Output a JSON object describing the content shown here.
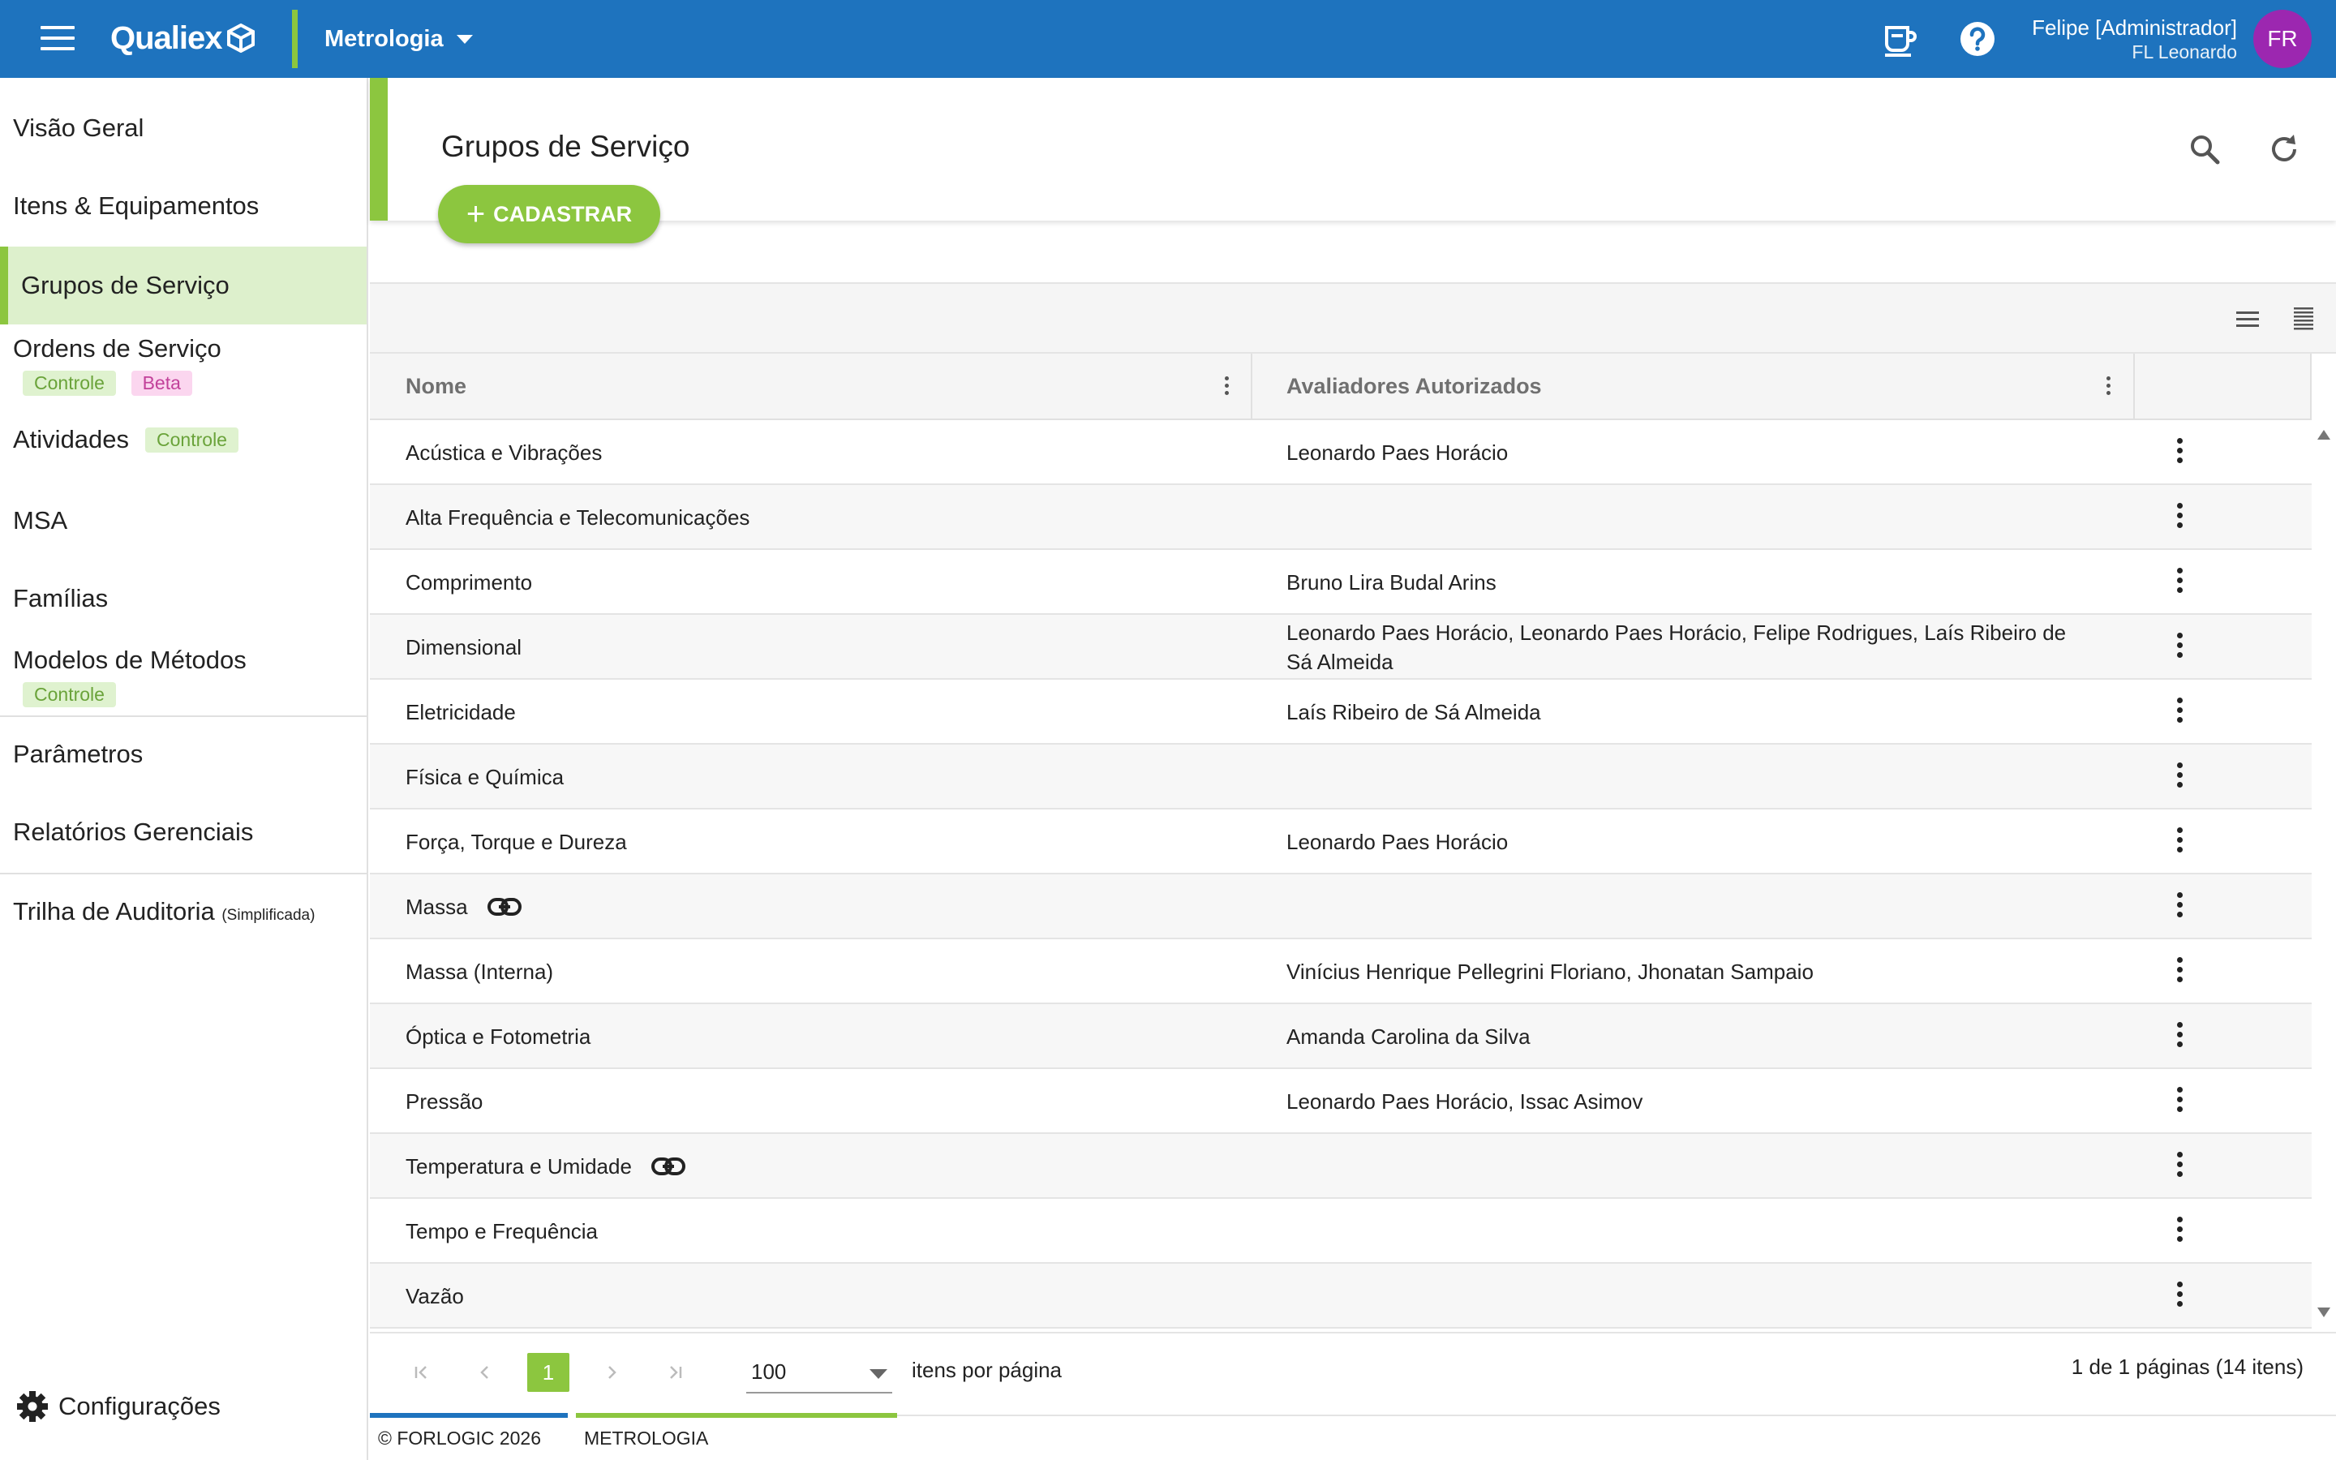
{
  "topbar": {
    "brand": "Qualiex",
    "module": "Metrologia",
    "user_name": "Felipe [Administrador]",
    "user_org": "FL Leonardo",
    "avatar_initials": "FR",
    "avatar_color": "#9c27b0",
    "color": "#1e73be"
  },
  "sidebar": {
    "items": [
      {
        "label": "Visão Geral"
      },
      {
        "label": "Itens & Equipamentos"
      },
      {
        "label": "Grupos de Serviço",
        "active": true
      },
      {
        "label": "Ordens de Serviço",
        "badges": [
          "Controle",
          "Beta"
        ]
      },
      {
        "label": "Atividades",
        "badges": [
          "Controle"
        ]
      },
      {
        "label": "MSA"
      },
      {
        "label": "Famílias"
      },
      {
        "label": "Modelos de Métodos",
        "badges": [
          "Controle"
        ]
      },
      {
        "label": "Parâmetros"
      },
      {
        "label": "Relatórios Gerenciais"
      },
      {
        "label": "Trilha de Auditoria",
        "suffix": "(Simplificada)"
      }
    ],
    "config_label": "Configurações",
    "accent": "#8cc63f"
  },
  "page": {
    "title": "Grupos de Serviço",
    "create_label": "CADASTRAR"
  },
  "table": {
    "columns": [
      "Nome",
      "Avaliadores Autorizados"
    ],
    "rows": [
      {
        "nome": "Acústica e Vibrações",
        "avaliadores": "Leonardo Paes Horácio",
        "link": false
      },
      {
        "nome": "Alta Frequência e Telecomunicações",
        "avaliadores": "",
        "link": false
      },
      {
        "nome": "Comprimento",
        "avaliadores": "Bruno Lira Budal Arins",
        "link": false
      },
      {
        "nome": "Dimensional",
        "avaliadores": "Leonardo Paes Horácio, Leonardo Paes Horácio, Felipe Rodrigues, Laís Ribeiro de Sá Almeida",
        "link": false
      },
      {
        "nome": "Eletricidade",
        "avaliadores": "Laís Ribeiro de Sá Almeida",
        "link": false
      },
      {
        "nome": "Física e Química",
        "avaliadores": "",
        "link": false
      },
      {
        "nome": "Força, Torque e Dureza",
        "avaliadores": "Leonardo Paes Horácio",
        "link": false
      },
      {
        "nome": "Massa",
        "avaliadores": "",
        "link": true
      },
      {
        "nome": "Massa (Interna)",
        "avaliadores": "Vinícius Henrique Pellegrini Floriano, Jhonatan Sampaio",
        "link": false
      },
      {
        "nome": "Óptica e Fotometria",
        "avaliadores": "Amanda Carolina da Silva",
        "link": false
      },
      {
        "nome": "Pressão",
        "avaliadores": "Leonardo Paes Horácio, Issac Asimov",
        "link": false
      },
      {
        "nome": "Temperatura e Umidade",
        "avaliadores": "",
        "link": true
      },
      {
        "nome": "Tempo e Frequência",
        "avaliadores": "",
        "link": false
      },
      {
        "nome": "Vazão",
        "avaliadores": "",
        "link": false
      }
    ]
  },
  "pager": {
    "current_page": "1",
    "page_size": "100",
    "page_size_label": "itens por página",
    "info": "1 de 1 páginas (14 itens)"
  },
  "footer": {
    "copyright": "© FORLOGIC 2026",
    "module": "METROLOGIA"
  }
}
